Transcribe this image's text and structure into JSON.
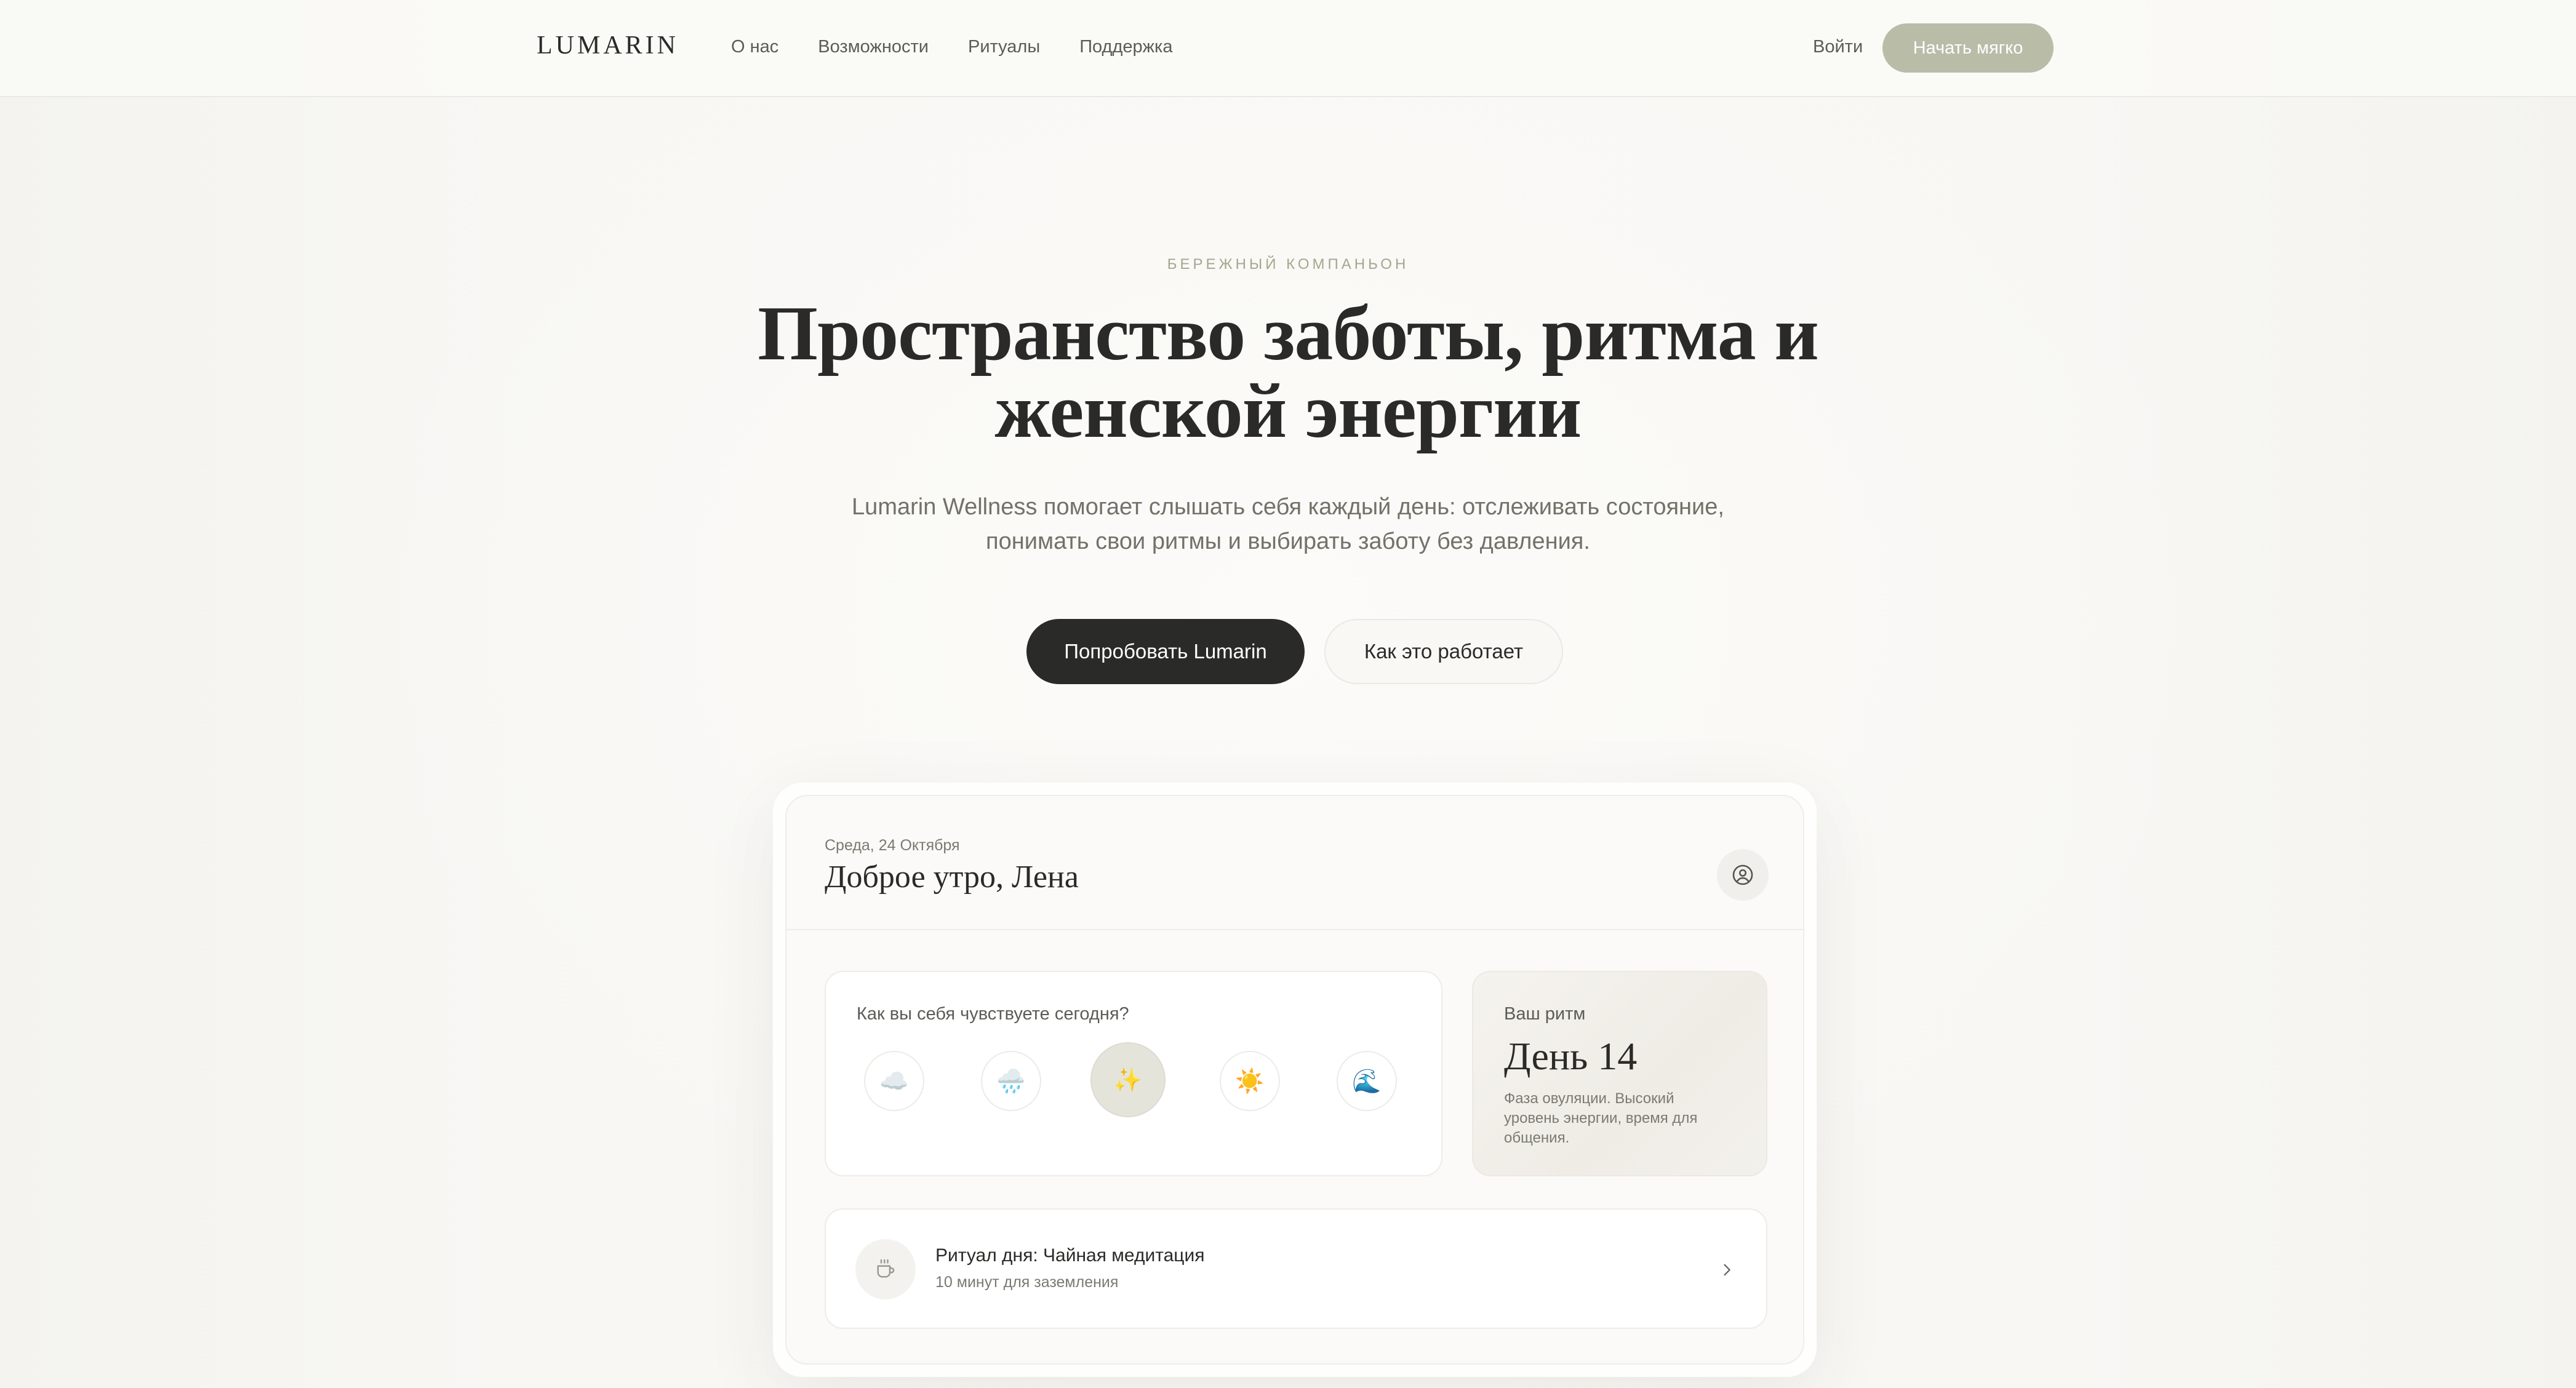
{
  "nav": {
    "logo": "LUMARIN",
    "links": [
      "О нас",
      "Возможности",
      "Ритуалы",
      "Поддержка"
    ],
    "login": "Войти",
    "start": "Начать мягко"
  },
  "hero": {
    "eyebrow": "БЕРЕЖНЫЙ КОМПАНЬОН",
    "headline_line1": "Пространство заботы, ритма и",
    "headline_line2": "женской энергии",
    "subtitle_line1": "Lumarin Wellness помогает слышать себя каждый день: отслеживать состояние,",
    "subtitle_line2": "понимать свои ритмы и выбирать заботу без давления.",
    "cta_primary": "Попробовать Lumarin",
    "cta_secondary": "Как это работает"
  },
  "app": {
    "date": "Среда, 24 Октября",
    "greeting": "Доброе утро, Лена",
    "mood": {
      "question": "Как вы себя чувствуете сегодня?",
      "options": [
        {
          "glyph": "☁️",
          "icon": "cloud-icon"
        },
        {
          "glyph": "🌧️",
          "icon": "rain-cloud-icon"
        },
        {
          "glyph": "✨",
          "icon": "sparkles-icon"
        },
        {
          "glyph": "☀️",
          "icon": "sun-icon"
        },
        {
          "glyph": "🌊",
          "icon": "wave-icon"
        }
      ],
      "selected_index": 2
    },
    "rhythm": {
      "label": "Ваш ритм",
      "day": "День 14",
      "desc_line1": "Фаза овуляции. Высокий",
      "desc_line2": "уровень энергии, время для",
      "desc_line3": "общения."
    },
    "ritual": {
      "title": "Ритуал дня: Чайная медитация",
      "subtitle": "10 минут для заземления",
      "icon": "tea-cup-icon"
    }
  },
  "colors": {
    "background": "#f8f7f4",
    "ink": "#2a2a28",
    "sage": "#b9bda8",
    "eyebrow": "#a3a78f",
    "muted": "#727269"
  }
}
